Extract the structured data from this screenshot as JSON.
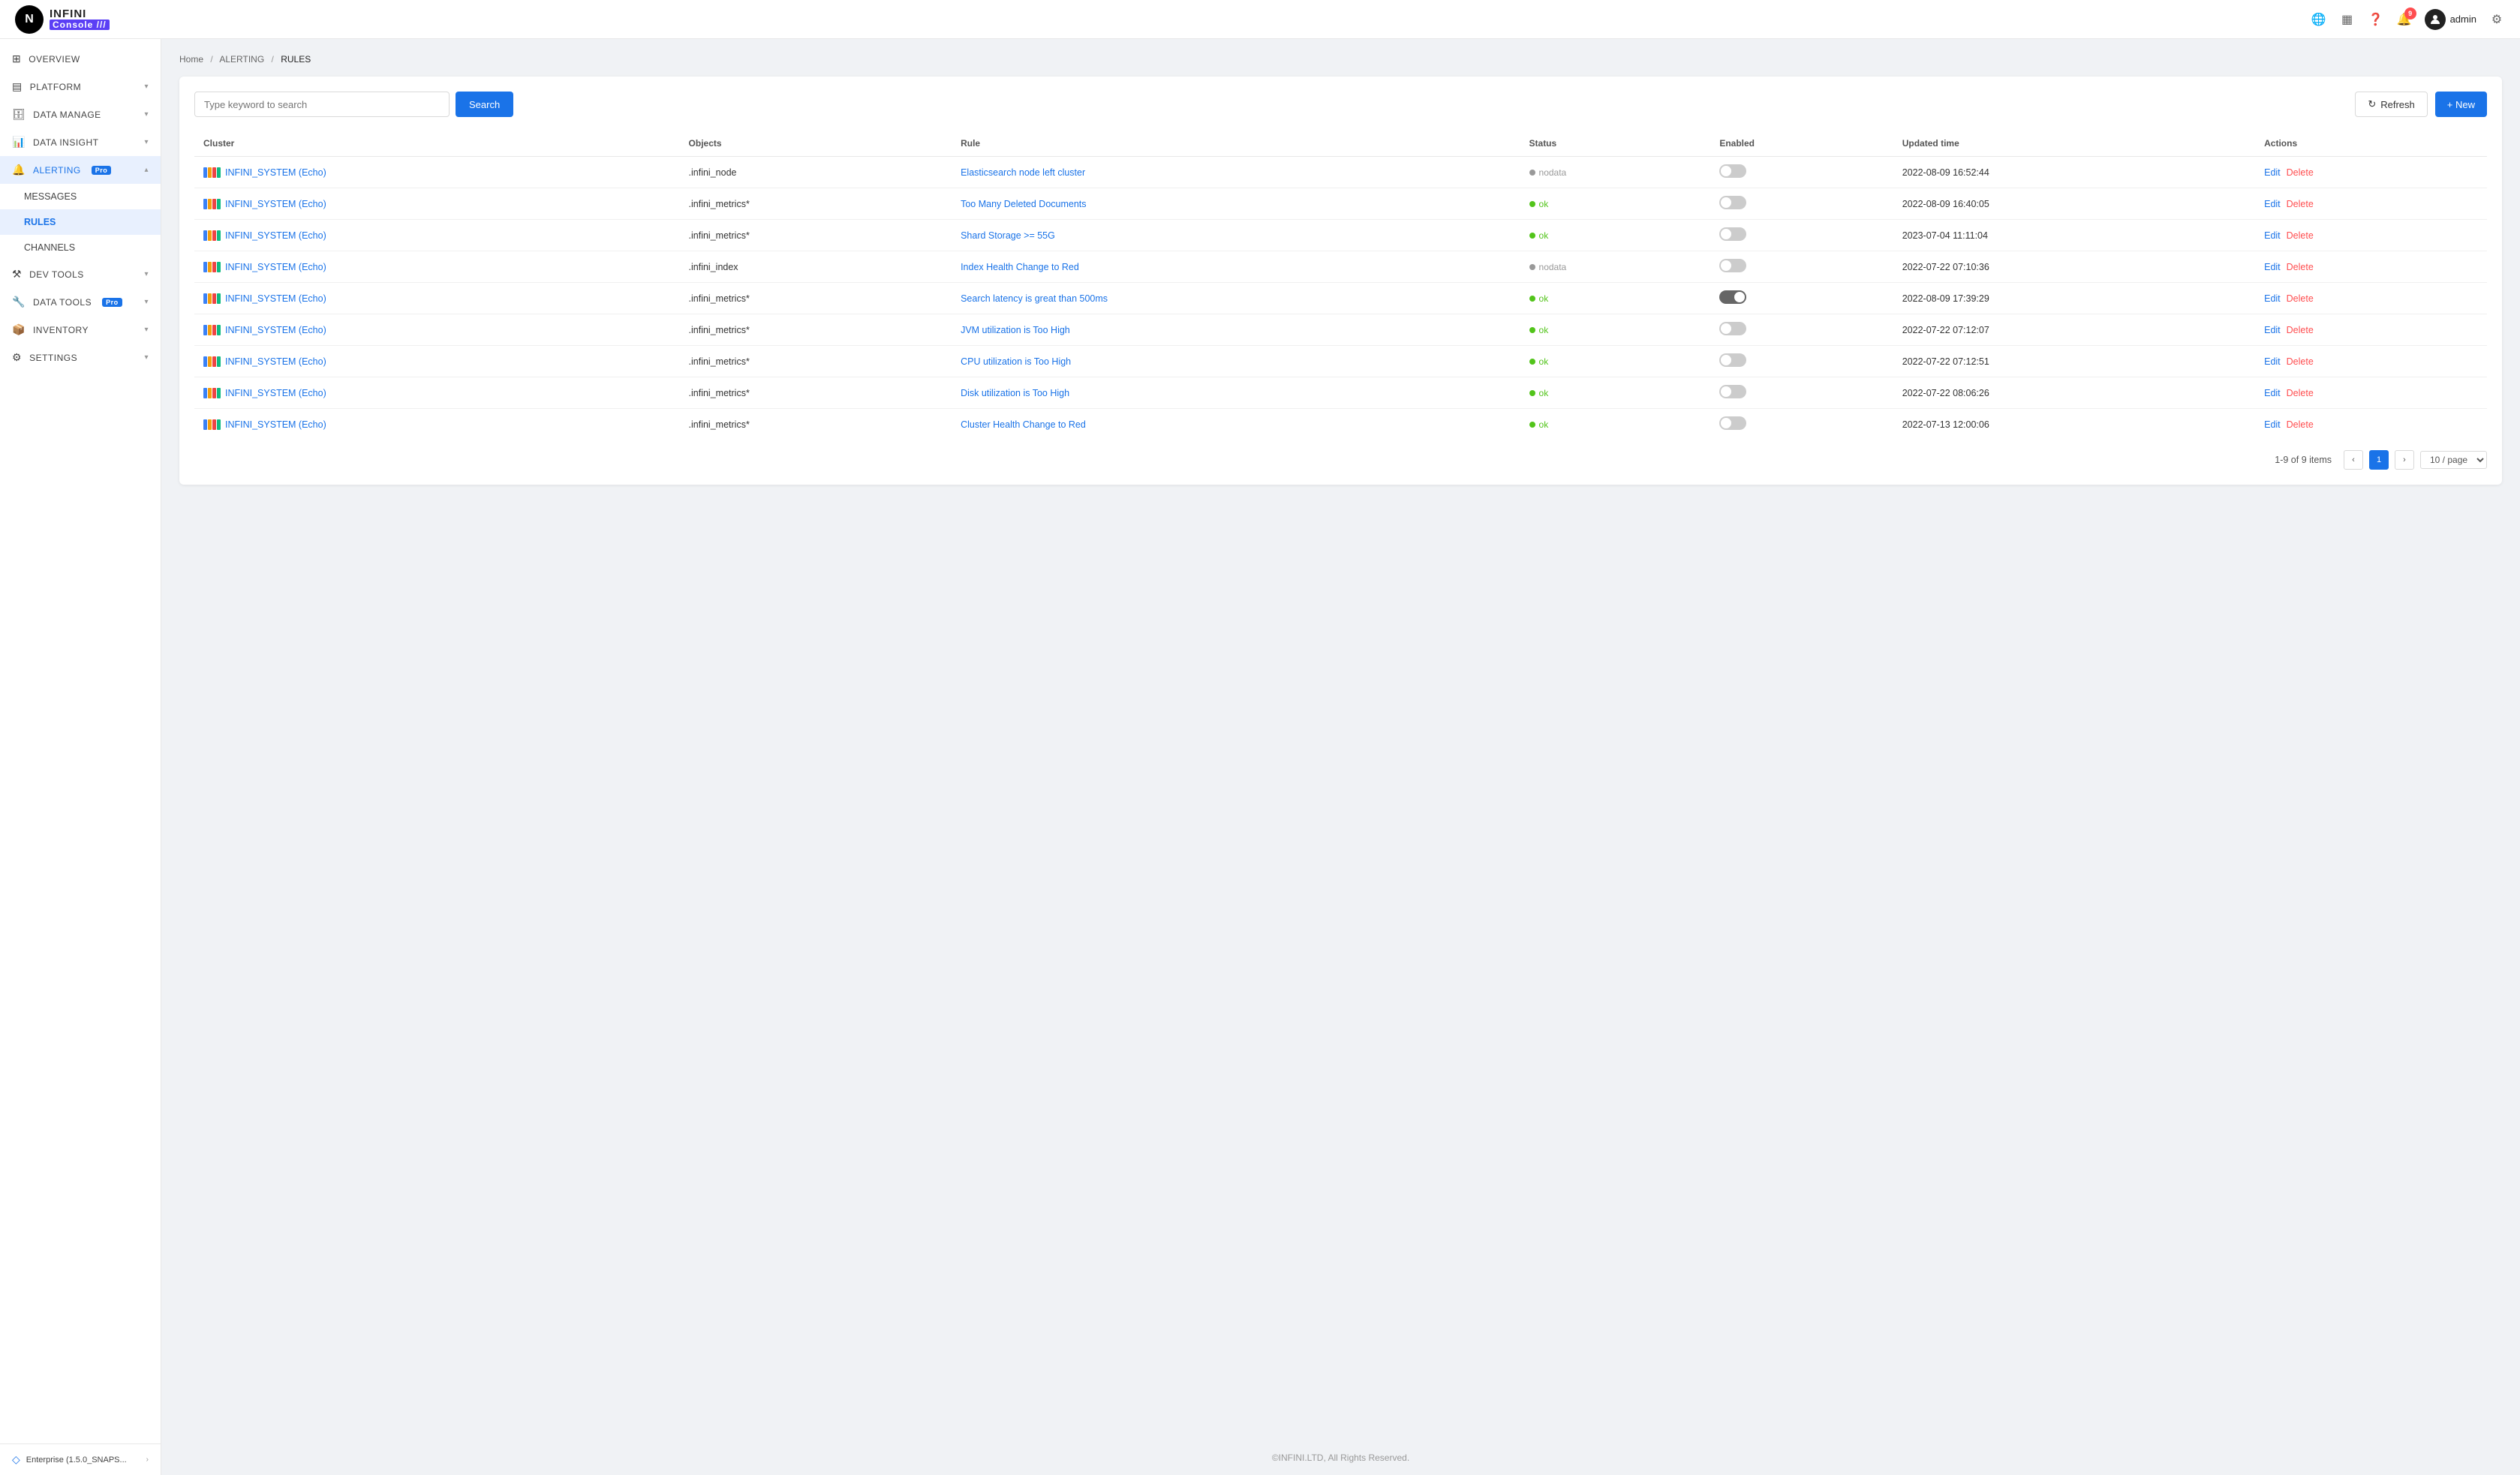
{
  "header": {
    "logo_letter": "N",
    "logo_infini": "INFINI",
    "logo_console": "Console ///",
    "notification_count": "9",
    "user_name": "admin"
  },
  "sidebar": {
    "items": [
      {
        "id": "overview",
        "label": "OVERVIEW",
        "icon": "⊞",
        "has_arrow": false,
        "active": false,
        "sub": false
      },
      {
        "id": "platform",
        "label": "PLATFORM",
        "icon": "▤",
        "has_arrow": true,
        "active": false,
        "sub": false
      },
      {
        "id": "data-manage",
        "label": "DATA MANAGE",
        "icon": "🗄",
        "has_arrow": true,
        "active": false,
        "sub": false
      },
      {
        "id": "data-insight",
        "label": "DATA INSIGHT",
        "icon": "📊",
        "has_arrow": true,
        "active": false,
        "sub": false
      },
      {
        "id": "alerting",
        "label": "ALERTING",
        "icon": "🔔",
        "has_arrow": true,
        "active": true,
        "sub": false,
        "badge": "Pro"
      },
      {
        "id": "messages",
        "label": "MESSAGES",
        "icon": "",
        "has_arrow": false,
        "active": false,
        "sub": true
      },
      {
        "id": "rules",
        "label": "RULES",
        "icon": "",
        "has_arrow": false,
        "active": true,
        "sub": true
      },
      {
        "id": "channels",
        "label": "CHANNELS",
        "icon": "",
        "has_arrow": false,
        "active": false,
        "sub": true
      },
      {
        "id": "dev-tools",
        "label": "DEV TOOLS",
        "icon": "⚒",
        "has_arrow": true,
        "active": false,
        "sub": false
      },
      {
        "id": "data-tools",
        "label": "DATA TOOLS",
        "icon": "🔧",
        "has_arrow": true,
        "active": false,
        "sub": false,
        "badge": "Pro"
      },
      {
        "id": "inventory",
        "label": "INVENTORY",
        "icon": "📦",
        "has_arrow": true,
        "active": false,
        "sub": false
      },
      {
        "id": "settings",
        "label": "SETTINGS",
        "icon": "⚙",
        "has_arrow": true,
        "active": false,
        "sub": false
      }
    ],
    "bottom_text": "Enterprise (1.5.0_SNAPS...",
    "bottom_icon": "◇"
  },
  "breadcrumb": {
    "items": [
      "Home",
      "ALERTING",
      "RULES"
    ],
    "separators": [
      "/",
      "/"
    ]
  },
  "toolbar": {
    "search_placeholder": "Type keyword to search",
    "search_label": "Search",
    "refresh_label": "Refresh",
    "new_label": "+ New"
  },
  "table": {
    "columns": [
      "Cluster",
      "Objects",
      "Rule",
      "Status",
      "Enabled",
      "Updated time",
      "Actions"
    ],
    "rows": [
      {
        "cluster": "INFINI_SYSTEM (Echo)",
        "objects": ".infini_node",
        "rule": "Elasticsearch node left cluster",
        "status": "nodata",
        "enabled": false,
        "updated_time": "2022-08-09 16:52:44"
      },
      {
        "cluster": "INFINI_SYSTEM (Echo)",
        "objects": ".infini_metrics*",
        "rule": "Too Many Deleted Documents",
        "status": "ok",
        "enabled": false,
        "updated_time": "2022-08-09 16:40:05"
      },
      {
        "cluster": "INFINI_SYSTEM (Echo)",
        "objects": ".infini_metrics*",
        "rule": "Shard Storage >= 55G",
        "status": "ok",
        "enabled": false,
        "updated_time": "2023-07-04 11:11:04"
      },
      {
        "cluster": "INFINI_SYSTEM (Echo)",
        "objects": ".infini_index",
        "rule": "Index Health Change to Red",
        "status": "nodata",
        "enabled": false,
        "updated_time": "2022-07-22 07:10:36"
      },
      {
        "cluster": "INFINI_SYSTEM (Echo)",
        "objects": ".infini_metrics*",
        "rule": "Search latency is great than 500ms",
        "status": "ok",
        "enabled": true,
        "updated_time": "2022-08-09 17:39:29"
      },
      {
        "cluster": "INFINI_SYSTEM (Echo)",
        "objects": ".infini_metrics*",
        "rule": "JVM utilization is Too High",
        "status": "ok",
        "enabled": false,
        "updated_time": "2022-07-22 07:12:07"
      },
      {
        "cluster": "INFINI_SYSTEM (Echo)",
        "objects": ".infini_metrics*",
        "rule": "CPU utilization is Too High",
        "status": "ok",
        "enabled": false,
        "updated_time": "2022-07-22 07:12:51"
      },
      {
        "cluster": "INFINI_SYSTEM (Echo)",
        "objects": ".infini_metrics*",
        "rule": "Disk utilization is Too High",
        "status": "ok",
        "enabled": false,
        "updated_time": "2022-07-22 08:06:26"
      },
      {
        "cluster": "INFINI_SYSTEM (Echo)",
        "objects": ".infini_metrics*",
        "rule": "Cluster Health Change to Red",
        "status": "ok",
        "enabled": false,
        "updated_time": "2022-07-13 12:00:06"
      }
    ],
    "edit_label": "Edit",
    "delete_label": "Delete"
  },
  "pagination": {
    "summary": "1-9 of 9 items",
    "current_page": "1",
    "per_page": "10 / page"
  },
  "footer": {
    "text": "©INFINI.LTD, All Rights Reserved."
  }
}
